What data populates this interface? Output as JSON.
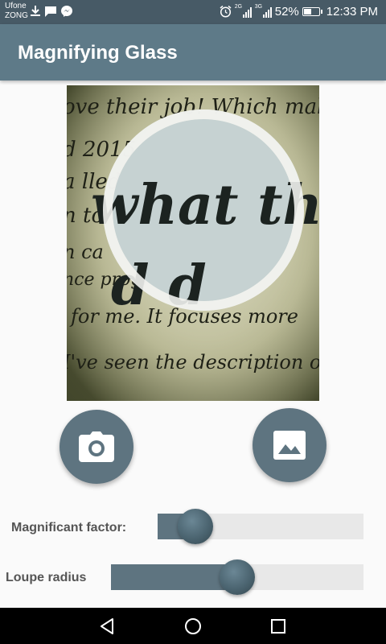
{
  "status_bar": {
    "carrier_1": "Ufone",
    "carrier_2": "ZONG",
    "signal_1_label": "2G",
    "signal_2_label": "3G",
    "battery_percent": "52%",
    "battery_level": 0.52,
    "time": "12:33 PM",
    "icons": [
      "download-icon",
      "message-icon",
      "messenger-icon",
      "alarm-icon",
      "signal-icon",
      "battery-icon"
    ]
  },
  "app_bar": {
    "title": "Magnifying Glass"
  },
  "actions": {
    "camera": "camera-icon",
    "gallery": "gallery-icon"
  },
  "controls": {
    "magnification": {
      "label": "Magnificant factor:",
      "value": 0.12
    },
    "loupe_radius": {
      "label": "Loupe radius",
      "value": 0.5
    }
  },
  "colors": {
    "status_bar": "#475a66",
    "app_bar": "#5e7a88",
    "accent": "#5e7480",
    "navigation_bar": "#000000"
  },
  "navigation": {
    "back": "back-icon",
    "home": "home-icon",
    "recents": "recents-icon"
  }
}
